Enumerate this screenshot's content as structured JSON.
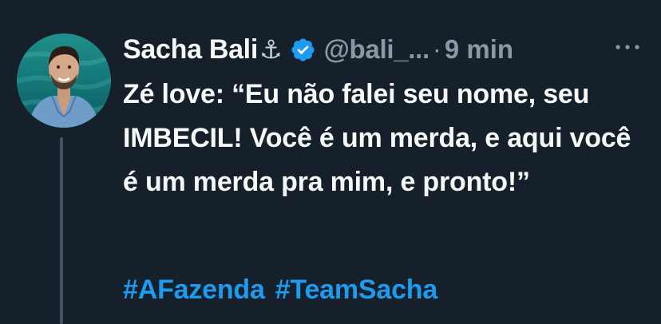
{
  "tweet": {
    "author_name": "Sacha Bali",
    "author_emoji": "⚓",
    "handle": "@bali_...",
    "separator": "·",
    "time": "9 min",
    "text": "Zé love: “Eu não falei seu nome, seu IMBECIL! Você é um merda, e aqui você é um merda pra mim, e pronto!”",
    "hashtags": [
      "#AFazenda",
      "#TeamSacha"
    ],
    "icons": {
      "verified": "verified-badge-icon",
      "more": "more-options-icon"
    }
  },
  "colors": {
    "background": "#15202b",
    "text": "#f7f9f9",
    "secondary": "#8b98a5",
    "accent": "#1d9bf0",
    "thread_line": "#425364"
  }
}
